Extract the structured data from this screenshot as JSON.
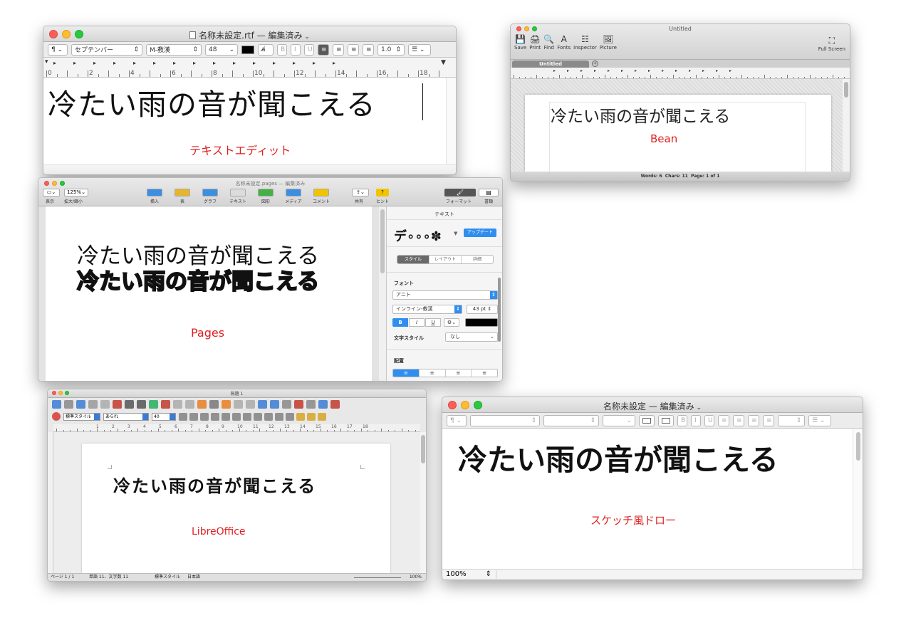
{
  "sample_text": "冷たい雨の音が聞こえる",
  "textedit": {
    "title": "名称未設定.rtf — 編集済み",
    "paragraph_btn": "¶",
    "font_family": "セプテンバー",
    "font_face": "M-教漢",
    "font_size": "48",
    "bold": "B",
    "italic": "I",
    "underline": "U",
    "line_spacing": "1.0",
    "ruler": [
      "0",
      "2",
      "4",
      "6",
      "8",
      "10",
      "12",
      "14",
      "16",
      "18"
    ],
    "label": "テキストエディット"
  },
  "bean": {
    "title": "Untitled",
    "toolbar": [
      "Save",
      "Print",
      "Find",
      "Fonts",
      "Inspector",
      "Picture"
    ],
    "fullscreen": "Full Screen",
    "tab": "Untitled",
    "label": "Bean",
    "status": "Words: 6  Chars: 11  Page: 1 of 1"
  },
  "pages": {
    "title": "名称未設定.pages — 編集済み",
    "zoom": "125%",
    "left_labels": [
      "表示",
      "拡大/縮小"
    ],
    "toolbar": [
      "挿入",
      "表",
      "グラフ",
      "テキスト",
      "図形",
      "メディア",
      "コメント"
    ],
    "right_labels": [
      "共有",
      "ヒント"
    ],
    "inspector_tabs": [
      "フォーマット",
      "書類"
    ],
    "panel_title": "テキスト",
    "style_preview": "デ∘∘∘✽",
    "update_btn": "アップデート",
    "seg_tabs": [
      "スタイル",
      "レイアウト",
      "詳細"
    ],
    "font_header": "フォント",
    "font_family": "アニト",
    "font_face": "インライン-教漢",
    "font_size": "43 pt",
    "char_style_label": "文字スタイル",
    "char_style_value": "なし",
    "align_header": "配置",
    "label": "Pages"
  },
  "libre": {
    "title": "無題 1",
    "para_style": "標準スタイル",
    "font_family": "あられ",
    "font_size": "40",
    "ruler": [
      "1",
      "2",
      "3",
      "4",
      "5",
      "6",
      "7",
      "8",
      "9",
      "10",
      "11",
      "12",
      "13",
      "14",
      "15",
      "16",
      "17",
      "18"
    ],
    "label": "LibreOffice",
    "status": [
      "ページ 1 / 1",
      "単語 11、文字数 11",
      "標準スタイル",
      "日本語"
    ],
    "zoom": "100%"
  },
  "sketch": {
    "title": "名称未設定 — 編集済み",
    "label": "スケッチ風ドロー",
    "zoom": "100%"
  }
}
